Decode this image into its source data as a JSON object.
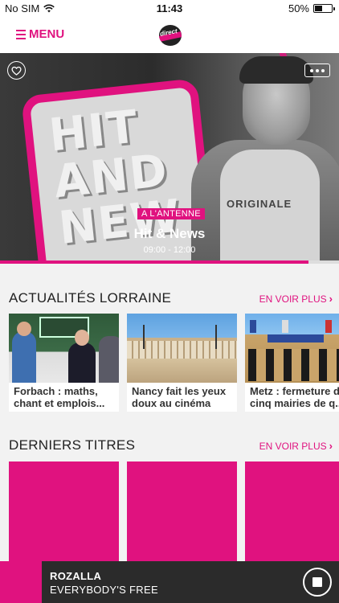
{
  "status_bar": {
    "carrier": "No SIM",
    "time": "11:43",
    "battery_percent": "50%",
    "battery_level": 0.5
  },
  "nav": {
    "menu_label": "MENU",
    "logo_text": "direct"
  },
  "hero": {
    "board_text": "HIT\nAND\nNEW",
    "shirt_text": "ORIGINALE",
    "badge": "A L'ANTENNE",
    "show_title": "Hit & News",
    "show_time": "09:00 - 12:00",
    "progress": 0.91
  },
  "news_section": {
    "title": "ACTUALITÉS LORRAINE",
    "see_more": "EN VOIR PLUS",
    "items": [
      {
        "title": "Forbach : maths,\nchant et emplois..."
      },
      {
        "title": "Nancy fait les yeux\ndoux au cinéma"
      },
      {
        "title": "Metz : fermeture d\ncinq mairies de q..."
      }
    ]
  },
  "titles_section": {
    "title": "DERNIERS TITRES",
    "see_more": "EN VOIR PLUS"
  },
  "player": {
    "artist": "ROZALLA",
    "track": "EVERYBODY'S FREE"
  },
  "colors": {
    "accent": "#e0127f",
    "player_bg": "#2b2b2b",
    "page_bg": "#f2f2f2"
  },
  "icons": {
    "wifi": "wifi-icon",
    "battery": "battery-icon",
    "menu": "hamburger-icon",
    "favorite": "heart-icon",
    "more": "more-dots-icon",
    "chevron": "chevron-right-icon",
    "stop": "stop-icon"
  }
}
